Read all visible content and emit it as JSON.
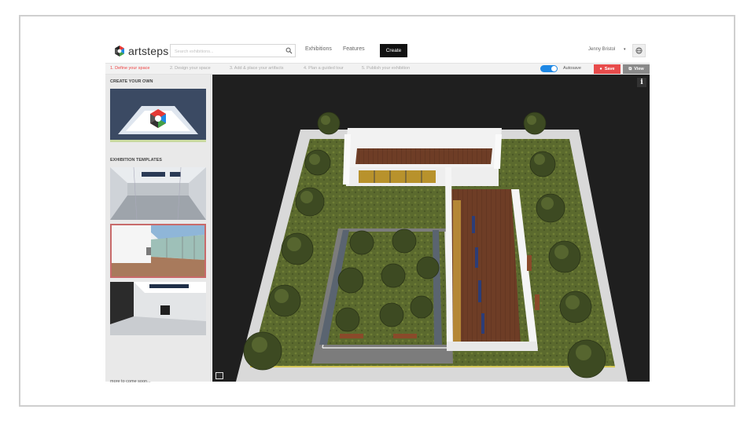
{
  "logo": {
    "text": "artsteps"
  },
  "search": {
    "placeholder": "Search exhibitions..."
  },
  "nav": {
    "exhibitions": "Exhibitions",
    "features": "Features",
    "create": "Create"
  },
  "user": {
    "name": "Jenny Bristol",
    "caret": "▾"
  },
  "steps": [
    "1. Define your space",
    "2. Design your space",
    "3. Add & place your artifacts",
    "4. Plan a guided tour",
    "5. Publish your exhibition"
  ],
  "toolbar": {
    "autosave_label": "Autosave",
    "autosave_on": true,
    "save_label": "Save",
    "view_label": "View"
  },
  "sidebar": {
    "create_heading": "CREATE YOUR OWN",
    "templates_heading": "EXHIBITION TEMPLATES",
    "more_link": "more to come soon..."
  },
  "viewport": {
    "info_label": "i"
  },
  "colors": {
    "accent_red": "#e84c4c",
    "toggle_blue": "#1e88e5",
    "active_step": "#e44444"
  }
}
